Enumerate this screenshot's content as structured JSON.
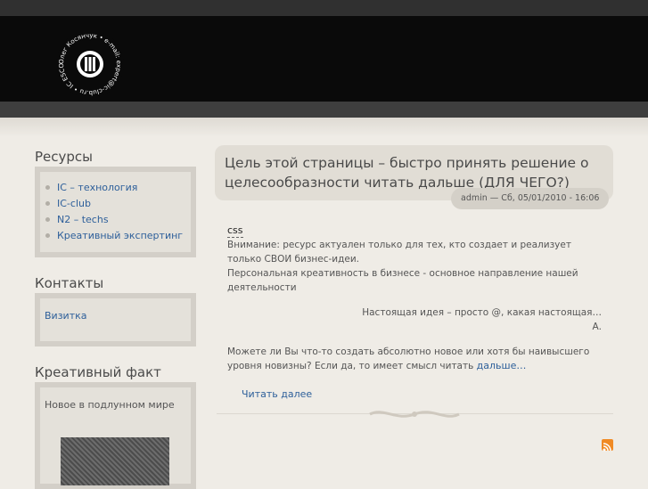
{
  "logo": {
    "ring_text": "Олег Косянчук • e-mail: expert@ic-club.ru • IC ESCO"
  },
  "sidebar": {
    "resources": {
      "title": "Ресурсы",
      "items": [
        {
          "label": "IC – технология"
        },
        {
          "label": "IC-club"
        },
        {
          "label": "N2 – techs"
        },
        {
          "label": "Креативный экспертинг"
        }
      ]
    },
    "contacts": {
      "title": "Контакты",
      "link": "Визитка"
    },
    "fact": {
      "title": "Креативный факт",
      "text": "Новое в подлунном мире"
    }
  },
  "node": {
    "title": "Цель этой страницы – быстро принять решение о целесообразности читать дальше (ДЛЯ ЧЕГО?)",
    "meta": "admin — Сб, 05/01/2010 - 16:06",
    "tag": "css",
    "p1": "Внимание: ресурс актуален только для тех, кто создает и реализует только СВОИ бизнес-идеи.",
    "p2": "Персональная креативность в бизнесе - основное направление нашей деятельности",
    "quote": "Настоящая идея – просто @, какая настоящая…",
    "signature": "А.",
    "p3": "Можете ли Вы что-то создать абсолютно новое или хотя бы наивысшего уровня новизны? Если да, то имеет смысл читать",
    "p3_link": "дальше…",
    "read_more": "Читать далее"
  }
}
